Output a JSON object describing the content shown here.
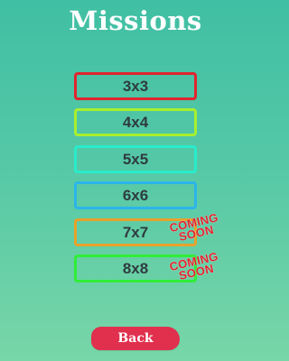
{
  "header": {
    "title": "Missions"
  },
  "missions": [
    {
      "label": "3x3",
      "border_color": "#e1252f",
      "available": true
    },
    {
      "label": "4x4",
      "border_color": "#a8ef2e",
      "available": true
    },
    {
      "label": "5x5",
      "border_color": "#28eccb",
      "available": true
    },
    {
      "label": "6x6",
      "border_color": "#2bb5ea",
      "available": true
    },
    {
      "label": "7x7",
      "border_color": "#e8a12a",
      "available": false,
      "badge": [
        "COMING",
        "SOON"
      ]
    },
    {
      "label": "8x8",
      "border_color": "#2fee37",
      "available": false,
      "badge": [
        "COMING",
        "SOON"
      ]
    }
  ],
  "footer": {
    "back_label": "Back"
  },
  "colors": {
    "background_top": "#40bfa4",
    "background_bottom": "#78d6a7",
    "badge_red": "#e5212c",
    "back_button": "#e0304e"
  }
}
